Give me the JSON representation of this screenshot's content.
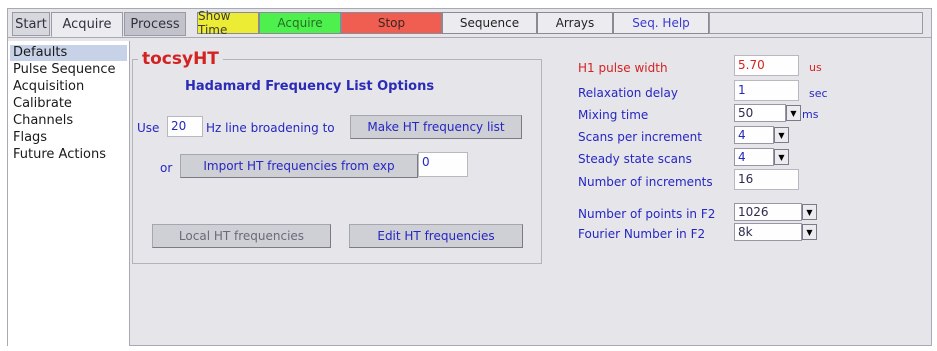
{
  "tabs": [
    {
      "label": "Start"
    },
    {
      "label": "Acquire"
    },
    {
      "label": "Process"
    }
  ],
  "toolbar": {
    "show_time": "Show Time",
    "acquire": "Acquire",
    "stop": "Stop",
    "sequence": "Sequence",
    "arrays": "Arrays",
    "seq_help": "Seq. Help"
  },
  "sidebar": {
    "items": [
      {
        "label": "Defaults"
      },
      {
        "label": "Pulse Sequence"
      },
      {
        "label": "Acquisition"
      },
      {
        "label": "Calibrate"
      },
      {
        "label": "Channels"
      },
      {
        "label": "Flags"
      },
      {
        "label": "Future Actions"
      }
    ]
  },
  "panel": {
    "title": "tocsyHT",
    "subtitle": "Hadamard Frequency List Options",
    "use_label": "Use",
    "line_broadening_value": "20",
    "hz_label": "Hz line broadening to",
    "make_list_button": "Make HT frequency list",
    "or_label": "or",
    "import_button": "Import HT frequencies from exp",
    "import_exp_value": "0",
    "local_button": "Local HT frequencies",
    "edit_button": "Edit HT frequencies"
  },
  "params": {
    "h1_pulse_width": {
      "label": "H1 pulse width",
      "value": "5.70",
      "unit": "us"
    },
    "relaxation_delay": {
      "label": "Relaxation delay",
      "value": "1",
      "unit": "sec"
    },
    "mixing_time": {
      "label": "Mixing time",
      "value": "50",
      "unit": "ms"
    },
    "scans_per_increment": {
      "label": "Scans per increment",
      "value": "4"
    },
    "steady_state_scans": {
      "label": "Steady state scans",
      "value": "4"
    },
    "number_of_increments": {
      "label": "Number of increments",
      "value": "16"
    },
    "points_f2": {
      "label": "Number of points in F2",
      "value": "1026"
    },
    "fourier_f2": {
      "label": "Fourier Number in F2",
      "value": "8k"
    }
  }
}
